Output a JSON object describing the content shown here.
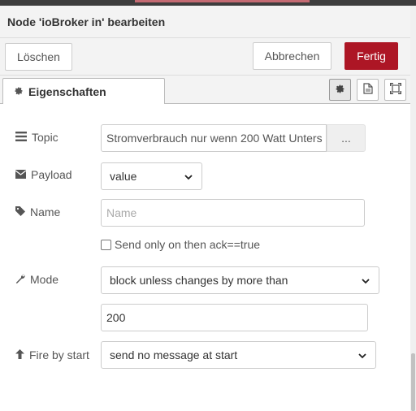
{
  "tray": {
    "title": "Node 'ioBroker in' bearbeiten"
  },
  "buttons": {
    "delete_label": "Löschen",
    "cancel_label": "Abbrechen",
    "done_label": "Fertig"
  },
  "tabs": {
    "properties_label": "Eigenschaften",
    "icons": [
      "gear-icon",
      "document-icon",
      "frame-icon"
    ]
  },
  "form": {
    "topic": {
      "label": "Topic",
      "value": "Stromverbrauch nur wenn 200 Watt Unters",
      "button_label": "..."
    },
    "payload": {
      "label": "Payload",
      "selected": "value"
    },
    "name": {
      "label": "Name",
      "value": "",
      "placeholder": "Name"
    },
    "ack": {
      "label": "Send only on then ack==true",
      "checked": false
    },
    "mode": {
      "label": "Mode",
      "selected": "block unless changes by more than"
    },
    "threshold": {
      "value": "200"
    },
    "fire_by_start": {
      "label": "Fire by start",
      "selected": "send no message at start"
    }
  },
  "colors": {
    "primary": "#ad1625",
    "header_bg": "#f3f3f3",
    "border": "#cccccc"
  }
}
